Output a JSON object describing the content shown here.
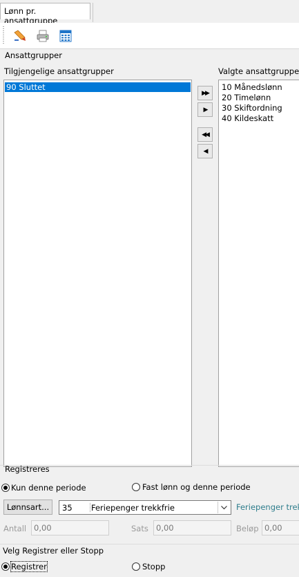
{
  "tab": {
    "label": "Lønn pr. ansattgruppe"
  },
  "toolbar": {
    "buttons": [
      {
        "icon": "pen-edit-icon"
      },
      {
        "icon": "printer-icon"
      },
      {
        "icon": "calendar-grid-icon"
      }
    ]
  },
  "groups": {
    "title": "Ansattgrupper",
    "available_label": "Tilgjengelige ansattgrupper",
    "selected_label": "Valgte ansattgrupper",
    "available": [
      "90 Sluttet"
    ],
    "selected": [
      "10 Månedslønn",
      "20 Timelønn",
      "30 Skiftordning",
      "40 Kildeskatt"
    ],
    "move_buttons": [
      "▶▶",
      "▶",
      "◀◀",
      "◀"
    ]
  },
  "registreres": {
    "title": "Registreres",
    "option1": "Kun denne periode",
    "option2": "Fast lønn og denne periode",
    "lonnsart_button": "Lønnsart...",
    "lonnsart_code": "35",
    "lonnsart_name": "Feriepenger trekkfrie",
    "lonnsart_link": "Feriepenger trek",
    "antall_label": "Antall",
    "antall_value": "0,00",
    "sats_label": "Sats",
    "sats_value": "0,00",
    "belop_label": "Beløp",
    "belop_value": "0,00"
  },
  "action": {
    "title": "Velg Registrer eller Stopp",
    "option_register": "Registrer",
    "option_stop": "Stopp"
  },
  "colors": {
    "selection": "#0078d7",
    "link": "#2e7d8c"
  }
}
